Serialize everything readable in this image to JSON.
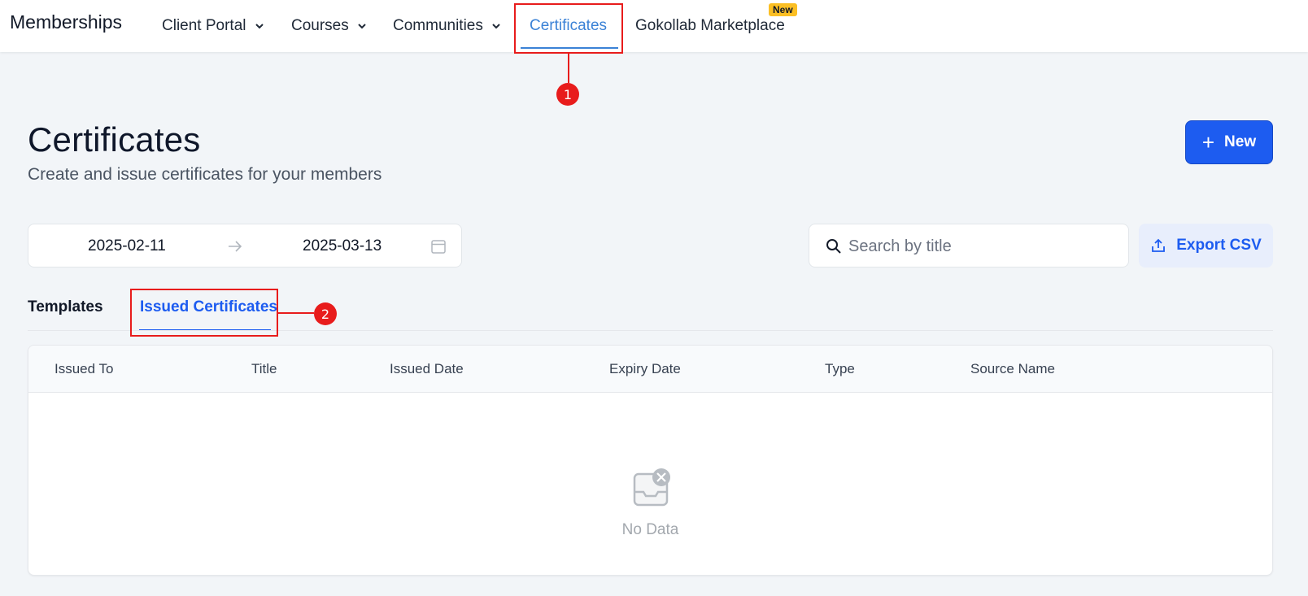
{
  "nav": {
    "brand": "Memberships",
    "items": [
      {
        "label": "Client Portal"
      },
      {
        "label": "Courses"
      },
      {
        "label": "Communities"
      },
      {
        "label": "Certificates"
      },
      {
        "label": "Gokollab Marketplace"
      }
    ],
    "new_badge": "New"
  },
  "annotations": {
    "step1": "1",
    "step2": "2"
  },
  "header": {
    "title": "Certificates",
    "subtitle": "Create and issue certificates for your members",
    "new_button": "New"
  },
  "filters": {
    "date_start": "2025-02-11",
    "date_end": "2025-03-13",
    "search_placeholder": "Search by title",
    "export_button": "Export CSV"
  },
  "tabs": {
    "templates": "Templates",
    "issued": "Issued Certificates"
  },
  "table": {
    "columns": [
      "Issued To",
      "Title",
      "Issued Date",
      "Expiry Date",
      "Type",
      "Source Name"
    ],
    "empty_text": "No Data"
  },
  "colors": {
    "accent": "#1d5cf0",
    "nav_active": "#3b82d6",
    "annotation": "#e81c1c",
    "badge": "#fbbf24"
  }
}
